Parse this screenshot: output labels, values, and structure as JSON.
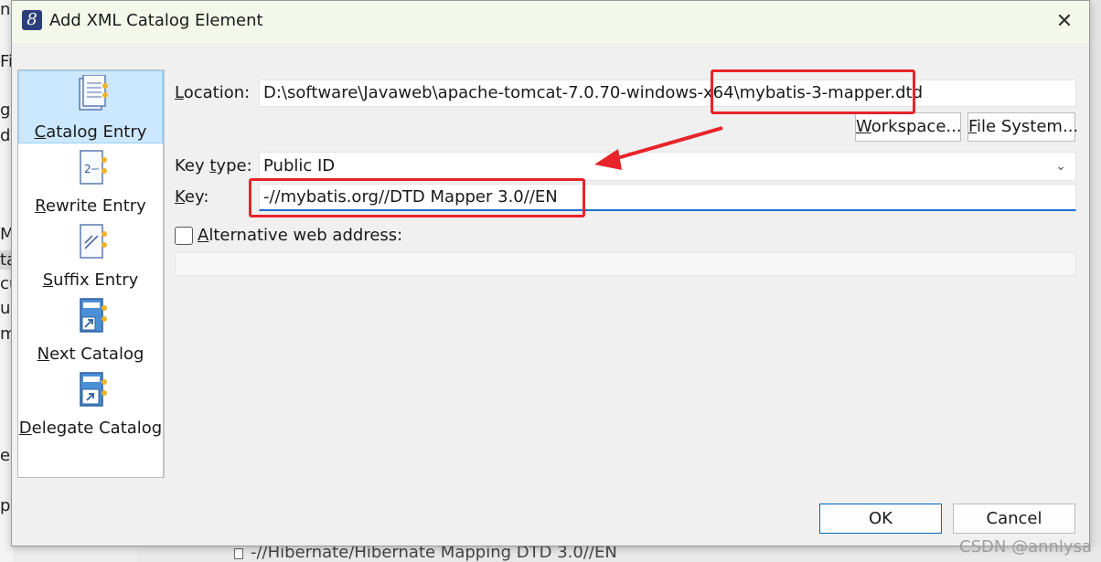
{
  "dialog": {
    "title": "Add XML Catalog Element",
    "app_icon_glyph": "8",
    "close_glyph": "✕"
  },
  "entries": [
    {
      "pre": "",
      "mnemonic": "C",
      "post": "atalog Entry",
      "icon": "catalog-entry-icon",
      "selected": true
    },
    {
      "pre": "",
      "mnemonic": "R",
      "post": "ewrite Entry",
      "icon": "rewrite-entry-icon",
      "selected": false
    },
    {
      "pre": "",
      "mnemonic": "S",
      "post": "uffix Entry",
      "icon": "suffix-entry-icon",
      "selected": false
    },
    {
      "pre": "",
      "mnemonic": "N",
      "post": "ext Catalog",
      "icon": "next-catalog-icon",
      "selected": false
    },
    {
      "pre": "",
      "mnemonic": "D",
      "post": "elegate Catalog",
      "icon": "delegate-catalog-icon",
      "selected": false
    }
  ],
  "form": {
    "location_label_mnemonic": "L",
    "location_label_rest": "ocation:",
    "location_value": "D:\\software\\Javaweb\\apache-tomcat-7.0.70-windows-x64\\mybatis-3-mapper.dtd",
    "workspace_button_mnemonic": "W",
    "workspace_button_rest": "orkspace...",
    "filesystem_button_mnemonic": "F",
    "filesystem_button_rest": "ile System...",
    "key_type_label_pre": "Key ",
    "key_type_label_mnemonic": "t",
    "key_type_label_post": "ype:",
    "key_type_value": "Public ID",
    "key_label_pre": "",
    "key_label_mnemonic": "K",
    "key_label_post": "ey:",
    "key_value": "-//mybatis.org//DTD Mapper 3.0//EN",
    "alt_web_address_mnemonic": "A",
    "alt_web_address_rest": "lternative web address:",
    "alt_web_address_checked": false,
    "alt_web_address_value": ""
  },
  "buttons": {
    "ok": "OK",
    "cancel": "Cancel"
  },
  "background": {
    "left_fragments": [
      "n",
      "Fi",
      "g",
      "di",
      "M",
      "ta",
      "cu",
      "ur",
      "m",
      "e",
      "p"
    ],
    "bottom_text": "-//Hibernate/Hibernate Mapping DTD 3.0//EN"
  },
  "watermark": "CSDN @annlysa",
  "colors": {
    "annotation_red": "#e8232a",
    "selection_blue": "#cce8ff",
    "focus_blue": "#1f6fd1"
  }
}
